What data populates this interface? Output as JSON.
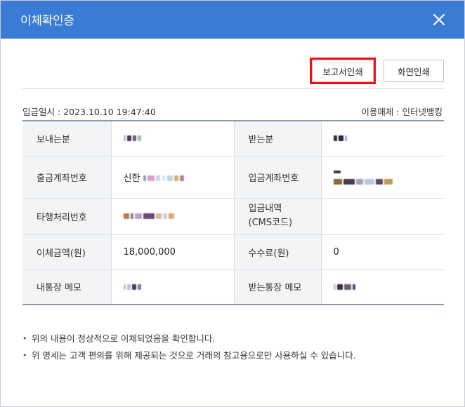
{
  "dialog": {
    "title": "이체확인증",
    "close_icon": "close-icon"
  },
  "toolbar": {
    "report_print_label": "보고서인쇄",
    "screen_print_label": "화면인쇄"
  },
  "meta": {
    "deposit_datetime": "입금일시 : 2023.10.10 19:47:40",
    "channel": "이용매체 : 인터넷뱅킹"
  },
  "table": {
    "sender_label": "보내는분",
    "sender_value": "",
    "receiver_label": "받는분",
    "receiver_value": "",
    "withdraw_account_label": "출금계좌번호",
    "withdraw_account_bank": "신한",
    "deposit_account_label": "입금계좌번호",
    "deposit_account_value": "",
    "other_bank_label": "타행처리번호",
    "other_bank_value": "",
    "deposit_detail_label_line1": "입금내역",
    "deposit_detail_label_line2": "(CMS코드)",
    "deposit_detail_value": "",
    "amount_label": "이체금액(원)",
    "amount_value": "18,000,000",
    "fee_label": "수수료(원)",
    "fee_value": "0",
    "my_memo_label": "내통장 메모",
    "my_memo_value": "",
    "receiver_memo_label": "받는통장 메모",
    "receiver_memo_value": ""
  },
  "notes": [
    "위의 내용이 정상적으로 이체되었음을 확인합니다.",
    "위 명세는 고객 편의를 위해 제공되는 것으로 거래의 참고용으로만 사용하실 수 있습니다."
  ],
  "colors": {
    "titlebar": "#3a7bd5",
    "highlight": "#ee1111"
  }
}
